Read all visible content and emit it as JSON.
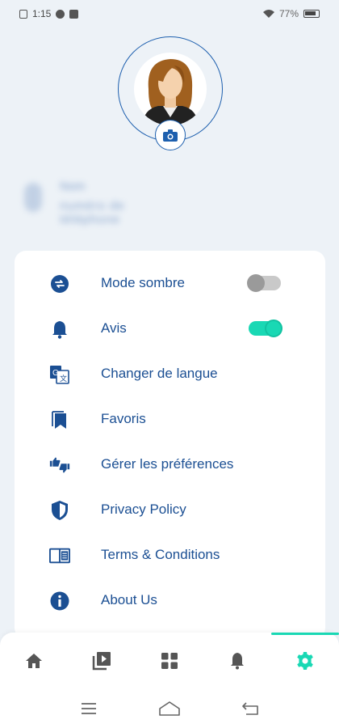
{
  "status_bar": {
    "time": "1:15",
    "battery": "77%"
  },
  "profile": {
    "name": "Nom",
    "subtitle": "numéro de téléphone"
  },
  "menu": {
    "items": [
      {
        "label": "Mode sombre",
        "icon": "toggle-arrows-icon",
        "toggle": "off"
      },
      {
        "label": "Avis",
        "icon": "bell-icon",
        "toggle": "on"
      },
      {
        "label": "Changer de langue",
        "icon": "translate-icon"
      },
      {
        "label": "Favoris",
        "icon": "bookmarks-icon"
      },
      {
        "label": "Gérer les préférences",
        "icon": "thumbs-icon"
      },
      {
        "label": "Privacy Policy",
        "icon": "shield-icon"
      },
      {
        "label": "Terms & Conditions",
        "icon": "book-icon"
      },
      {
        "label": "About Us",
        "icon": "info-icon"
      }
    ]
  },
  "bottom_nav": {
    "items": [
      "home-icon",
      "video-library-icon",
      "grid-icon",
      "notification-bell-icon",
      "settings-gear-icon"
    ],
    "active": "settings-gear-icon"
  },
  "colors": {
    "primary": "#1d4f91",
    "accent": "#19d8b4",
    "background": "#edf2f7"
  }
}
